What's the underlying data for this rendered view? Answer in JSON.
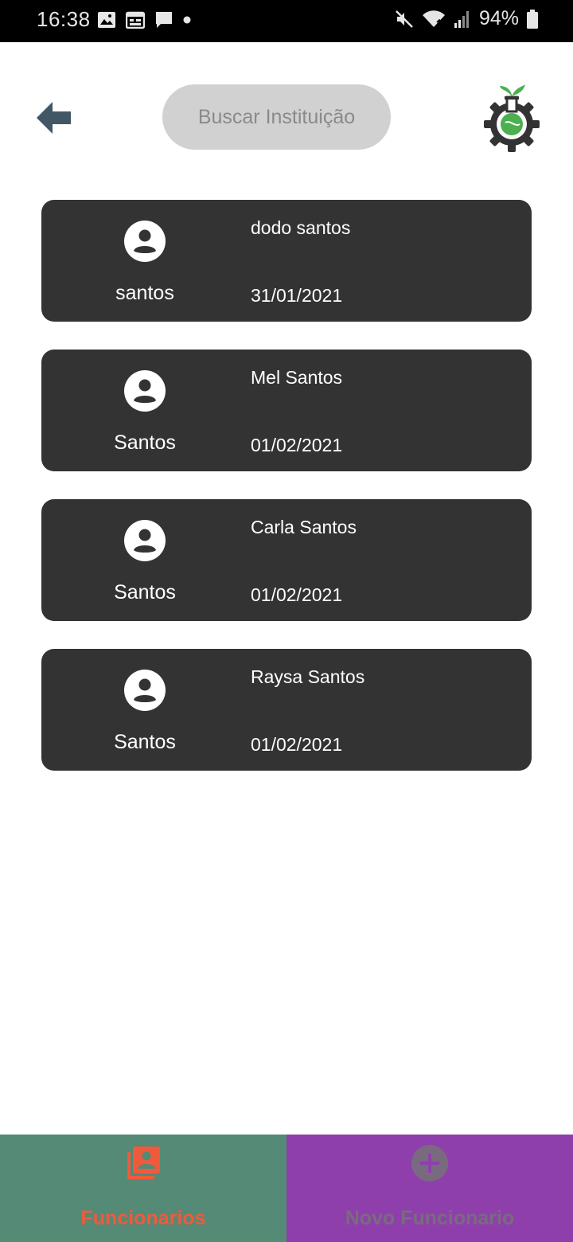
{
  "status_bar": {
    "time": "16:38",
    "battery": "94%",
    "icons": [
      "image-icon",
      "calendar-icon",
      "chat-icon",
      "dot-icon",
      "mute-icon",
      "wifi-icon",
      "signal-icon",
      "battery-icon"
    ]
  },
  "header": {
    "back_icon": "arrow-left-icon",
    "search_placeholder": "Buscar Instituição",
    "logo_icon": "gear-flask-logo"
  },
  "employees": [
    {
      "short_name": "santos",
      "full_name": "dodo santos",
      "date": "31/01/2021"
    },
    {
      "short_name": "Santos",
      "full_name": "Mel Santos",
      "date": "01/02/2021"
    },
    {
      "short_name": "Santos",
      "full_name": "Carla Santos",
      "date": "01/02/2021"
    },
    {
      "short_name": "Santos",
      "full_name": "Raysa Santos",
      "date": "01/02/2021"
    }
  ],
  "bottom_nav": {
    "tabs": [
      {
        "label": "Funcionarios",
        "icon": "contacts-icon",
        "active": true
      },
      {
        "label": "Novo Funcionario",
        "icon": "add-circle-icon",
        "active": false
      }
    ]
  },
  "colors": {
    "card_bg": "#333333",
    "active_tab_bg": "#548a76",
    "inactive_tab_bg": "#8e3fac",
    "active_label": "#f05a3c",
    "search_bg": "#d1d1d1",
    "logo_green": "#4caf50"
  }
}
